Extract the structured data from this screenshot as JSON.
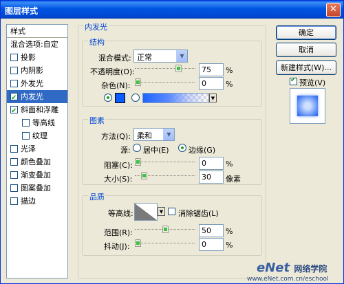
{
  "window": {
    "title": "图层样式",
    "close": "✕"
  },
  "stylelist": {
    "items": [
      {
        "label": "样式",
        "checkbox": false,
        "checked": false,
        "selected": false,
        "sub": false
      },
      {
        "label": "混合选项:自定",
        "checkbox": false,
        "checked": false,
        "selected": false,
        "sub": false
      },
      {
        "label": "投影",
        "checkbox": true,
        "checked": false,
        "selected": false,
        "sub": false
      },
      {
        "label": "内阴影",
        "checkbox": true,
        "checked": false,
        "selected": false,
        "sub": false
      },
      {
        "label": "外发光",
        "checkbox": true,
        "checked": false,
        "selected": false,
        "sub": false
      },
      {
        "label": "内发光",
        "checkbox": true,
        "checked": true,
        "selected": true,
        "sub": false
      },
      {
        "label": "斜面和浮雕",
        "checkbox": true,
        "checked": true,
        "selected": false,
        "sub": false
      },
      {
        "label": "等高线",
        "checkbox": true,
        "checked": false,
        "selected": false,
        "sub": true
      },
      {
        "label": "纹理",
        "checkbox": true,
        "checked": false,
        "selected": false,
        "sub": true
      },
      {
        "label": "光泽",
        "checkbox": true,
        "checked": false,
        "selected": false,
        "sub": false
      },
      {
        "label": "颜色叠加",
        "checkbox": true,
        "checked": false,
        "selected": false,
        "sub": false
      },
      {
        "label": "渐变叠加",
        "checkbox": true,
        "checked": false,
        "selected": false,
        "sub": false
      },
      {
        "label": "图案叠加",
        "checkbox": true,
        "checked": false,
        "selected": false,
        "sub": false
      },
      {
        "label": "描边",
        "checkbox": true,
        "checked": false,
        "selected": false,
        "sub": false
      }
    ]
  },
  "panel": {
    "title": "内发光",
    "structure": {
      "legend": "结构",
      "blend_mode_label": "混合模式:",
      "blend_mode_value": "正常",
      "opacity_label": "不透明度(O):",
      "opacity_value": "75",
      "opacity_unit": "%",
      "opacity_fraction": 0.75,
      "noise_label": "杂色(N):",
      "noise_value": "0",
      "noise_unit": "%",
      "color": "#0a5cff"
    },
    "elements": {
      "legend": "图素",
      "method_label": "方法(Q):",
      "method_value": "柔和",
      "source_label": "源:",
      "source_center": "居中(E)",
      "source_edge": "边缘(G)",
      "choke_label": "阻塞(C):",
      "choke_value": "0",
      "choke_unit": "%",
      "size_label": "大小(S):",
      "size_value": "30",
      "size_unit": "像素",
      "size_fraction": 0.12
    },
    "quality": {
      "legend": "品质",
      "contour_label": "等高线:",
      "antialias_label": "消除锯齿(L)",
      "range_label": "范围(R):",
      "range_value": "50",
      "range_unit": "%",
      "range_fraction": 0.5,
      "jitter_label": "抖动(J):",
      "jitter_value": "0",
      "jitter_unit": "%"
    }
  },
  "buttons": {
    "ok": "确定",
    "cancel": "取消",
    "new_style": "新建样式(W)...",
    "preview_label": "预览(V)"
  },
  "watermark": {
    "brand": "eNet",
    "cn": "网络学院",
    "url": "www.eNet.com.cn/eschool"
  }
}
